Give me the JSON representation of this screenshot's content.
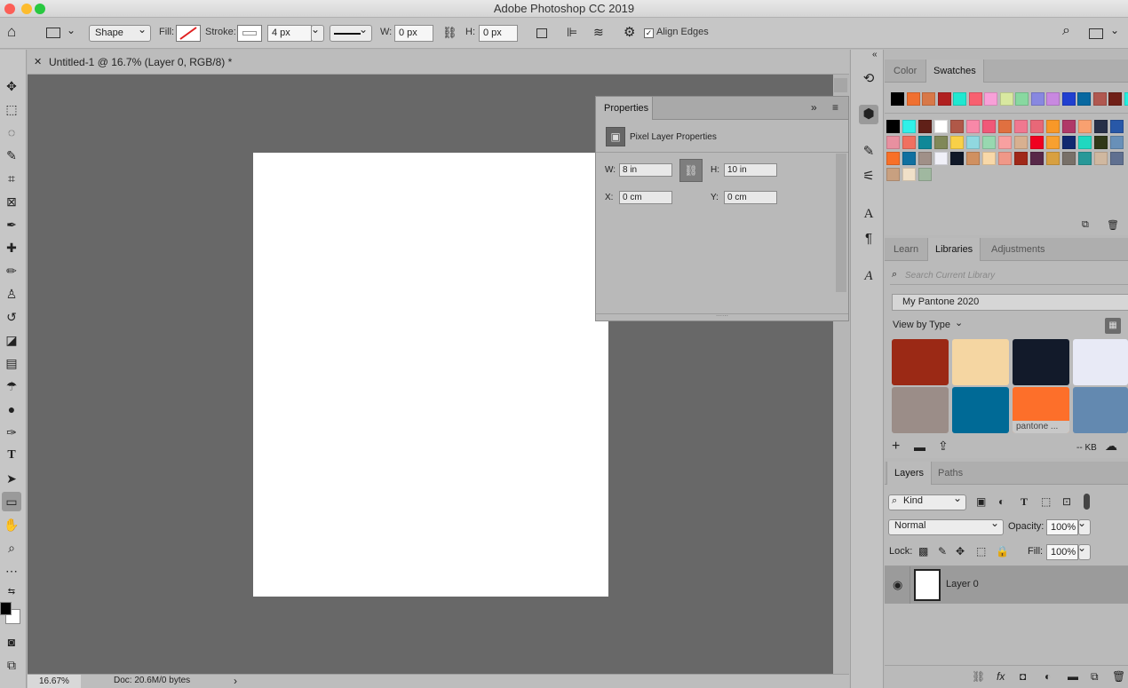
{
  "window": {
    "title": "Adobe Photoshop CC 2019"
  },
  "options_bar": {
    "tool_mode": "Shape",
    "fill_label": "Fill:",
    "stroke_label": "Stroke:",
    "stroke_width": "4 px",
    "w_label": "W:",
    "w_value": "0 px",
    "h_label": "H:",
    "h_value": "0 px",
    "align_edges_label": "Align Edges",
    "align_edges_checked": true
  },
  "document": {
    "tab_title": "Untitled-1 @ 16.7% (Layer 0, RGB/8) *",
    "zoom": "16.67%",
    "doc_info": "Doc: 20.6M/0 bytes"
  },
  "properties": {
    "title": "Properties",
    "subtitle": "Pixel Layer Properties",
    "w_label": "W:",
    "w_value": "8 in",
    "h_label": "H:",
    "h_value": "10 in",
    "x_label": "X:",
    "x_value": "0 cm",
    "y_label": "Y:",
    "y_value": "0 cm"
  },
  "color_panel": {
    "tabs": [
      "Color",
      "Swatches"
    ],
    "active_tab": "Swatches",
    "recent": [
      "#000000",
      "#f07030",
      "#d87848",
      "#b02020",
      "#20e8d0",
      "#f86070",
      "#f8a0d8",
      "#d8e8a0",
      "#88d8a0",
      "#8888e0",
      "#c888e0",
      "#2040d0",
      "#0868a0",
      "#b05850",
      "#702018",
      "#20f0e0"
    ],
    "rows": [
      [
        "#000000",
        "#30f0e8",
        "#602018",
        "#ffffff",
        "#b05848",
        "#f888a8",
        "#f05878",
        "#e07040",
        "#f07890",
        "#e86878",
        "#f89828",
        "#b03868",
        "#f8a070",
        "#283048",
        "#2858a8"
      ],
      [
        "#e890a0",
        "#f07060",
        "#108898",
        "#808858",
        "#f8d048",
        "#90d8e0",
        "#98d8b0",
        "#f8a0a0",
        "#d8b090",
        "#f00020",
        "#f8a030",
        "#102870",
        "#20d8c0",
        "#303818",
        "#6890b8"
      ],
      [
        "#f87028",
        "#1070a0",
        "#a09088",
        "#f0f0f8",
        "#101828",
        "#d09060",
        "#f8d8a8",
        "#f09888",
        "#a02818",
        "#582848",
        "#d8a040",
        "#787068",
        "#289898",
        "#d0b8a0",
        "#607090"
      ],
      [
        "#c8a080",
        "#f0e0c8",
        "#a0b8a0"
      ]
    ]
  },
  "libraries_panel": {
    "tabs": [
      "Learn",
      "Libraries",
      "Adjustments"
    ],
    "active_tab": "Libraries",
    "search_placeholder": "Search Current Library",
    "library_name": "My Pantone 2020",
    "view_by": "View by Type",
    "swatches": [
      {
        "color": "#9b2915",
        "label": ""
      },
      {
        "color": "#f5d6a2",
        "label": ""
      },
      {
        "color": "#121a2a",
        "label": ""
      },
      {
        "color": "#e8eaf6",
        "label": ""
      },
      {
        "color": "#9b8d88",
        "label": ""
      },
      {
        "color": "#006a96",
        "label": ""
      },
      {
        "color": "#fd6f2a",
        "label": "pantone ..."
      },
      {
        "color": "#6389b0",
        "label": ""
      }
    ],
    "size_text": "-- KB"
  },
  "layers_panel": {
    "tabs": [
      "Layers",
      "Paths"
    ],
    "active_tab": "Layers",
    "filter_kind": "Kind",
    "blend_mode": "Normal",
    "opacity_label": "Opacity:",
    "opacity": "100%",
    "lock_label": "Lock:",
    "fill_label": "Fill:",
    "fill": "100%",
    "layers": [
      {
        "name": "Layer 0",
        "visible": true
      }
    ]
  },
  "colors": {
    "foreground": "#000000",
    "background": "#ffffff"
  }
}
